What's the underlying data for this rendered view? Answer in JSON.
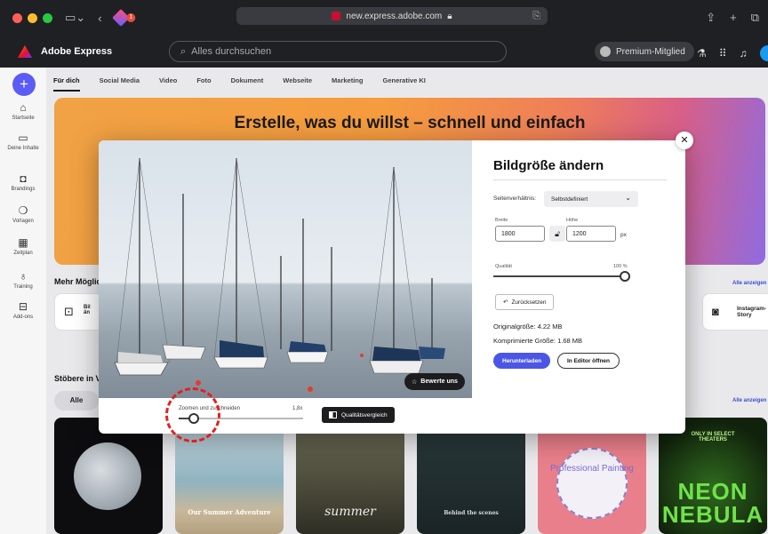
{
  "browser": {
    "url": "new.express.adobe.com",
    "extension_badge": "1",
    "traffic_colors": [
      "#ff5f57",
      "#febc2e",
      "#28c840"
    ]
  },
  "app": {
    "name": "Adobe Express",
    "search_placeholder": "Alles durchsuchen",
    "premium_label": "Premium-Mitglied"
  },
  "sidebar": {
    "items": [
      {
        "label": "Startseite",
        "icon": "home-icon"
      },
      {
        "label": "Deine Inhalte",
        "icon": "folder-icon"
      },
      {
        "label": "Brandings",
        "icon": "brand-icon"
      },
      {
        "label": "Vorlagen",
        "icon": "template-icon"
      },
      {
        "label": "Zeitplan",
        "icon": "calendar-icon"
      },
      {
        "label": "Training",
        "icon": "lightbulb-icon"
      },
      {
        "label": "Add-ons",
        "icon": "addons-icon"
      }
    ]
  },
  "tabs": [
    "Für dich",
    "Social Media",
    "Video",
    "Foto",
    "Dokument",
    "Webseite",
    "Marketing",
    "Generative KI"
  ],
  "hero": {
    "title": "Erstelle, was du willst – schnell und einfach"
  },
  "sections": {
    "more": "Mehr Möglic",
    "browse": "Stöbere in V",
    "show_all": "Alle anzeigen",
    "filter_all": "Alle",
    "card_partial": "Bil än",
    "instagram": "Instagram-Story"
  },
  "thumbnails": [
    {
      "text": ""
    },
    {
      "text": "Our Summer Adventure"
    },
    {
      "text": "summer"
    },
    {
      "text": "Behind the scenes"
    },
    {
      "text": "Professional Painting"
    },
    {
      "text": "NEON NEBULA",
      "top": "ONLY IN SELECT THEATERS"
    }
  ],
  "modal": {
    "rate_button": "Bewerte uns",
    "zoom_label": "Zoomen und zuschneiden",
    "zoom_value": "1,8x",
    "zoom_fraction": 0.12,
    "compare_button": "Qualitätsvergleich",
    "panel": {
      "title": "Bildgröße ändern",
      "aspect_label": "Seitenverhältnis:",
      "aspect_value": "Selbstdefiniert",
      "width_label": "Breite",
      "height_label": "Höhe",
      "width_value": "1800",
      "height_value": "1200",
      "unit": "px",
      "quality_label": "Qualität",
      "quality_value": "100 %",
      "reset_button": "Zurücksetzen",
      "original_size": "Originalgröße:  4.22 MB",
      "compressed_size": "Komprimierte Größe:  1.68 MB",
      "download_button": "Herunterladen",
      "editor_button": "In Editor öffnen"
    }
  }
}
